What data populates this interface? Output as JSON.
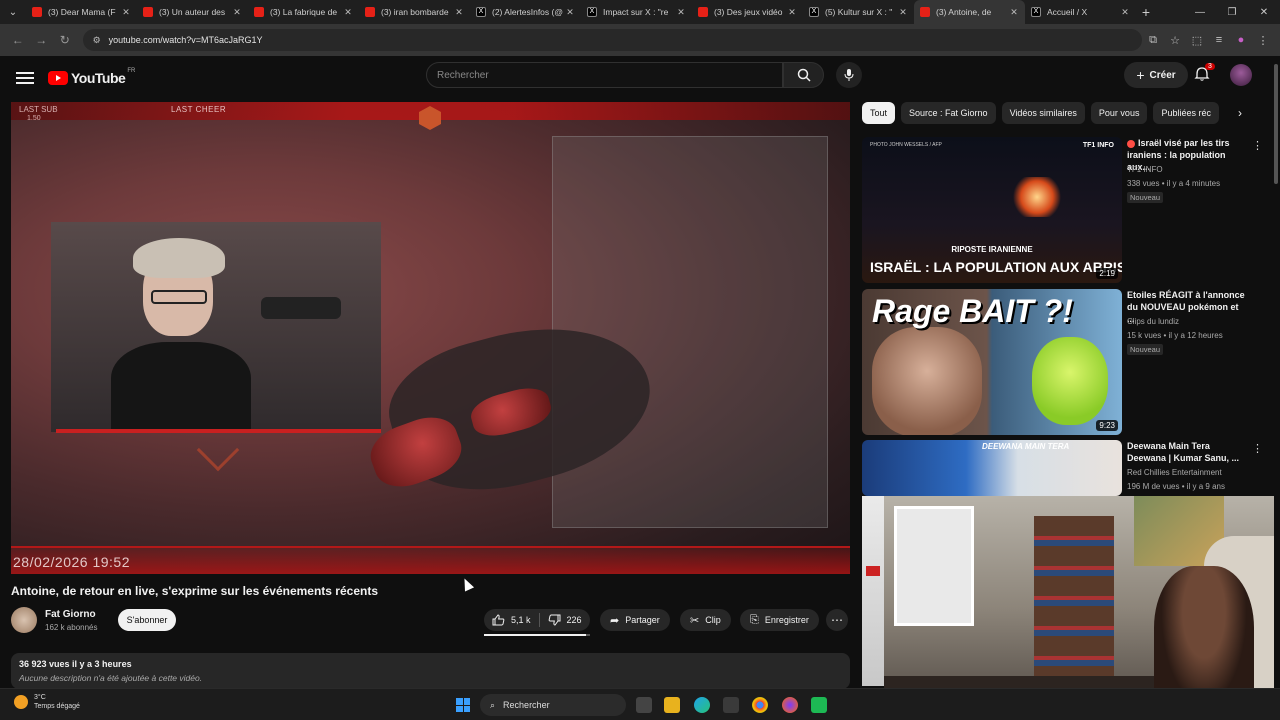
{
  "browser": {
    "tabs": [
      {
        "title": "(3) Dear Mama (F",
        "icon": "youtube-icon"
      },
      {
        "title": "(3) Un auteur des",
        "icon": "youtube-icon"
      },
      {
        "title": "(3) La fabrique de",
        "icon": "youtube-icon"
      },
      {
        "title": "(3) iran bombarde",
        "icon": "youtube-icon"
      },
      {
        "title": "(2) AlertesInfos (@",
        "icon": "x-icon"
      },
      {
        "title": "Impact sur X : \"re",
        "icon": "x-icon"
      },
      {
        "title": "(3) Des jeux vidéo",
        "icon": "youtube-icon"
      },
      {
        "title": "(5) Kultur sur X : \"",
        "icon": "x-icon"
      },
      {
        "title": "(3) Antoine, de",
        "icon": "youtube-icon",
        "active": true
      },
      {
        "title": "Accueil / X",
        "icon": "x-icon"
      }
    ],
    "url": "youtube.com/watch?v=MT6acJaRG1Y"
  },
  "youtube": {
    "logo_text": "YouTube",
    "region": "FR",
    "search_placeholder": "Rechercher",
    "create_label": "Créer",
    "notif_count": "3"
  },
  "player": {
    "overlay_last_sub": "LAST SUB",
    "overlay_last_sub_value": "1.50",
    "overlay_last_cheer": "LAST CHEER",
    "timestamp": "28/02/2026   19:52"
  },
  "video": {
    "title": "Antoine, de retour en live, s'exprime sur les événements récents",
    "channel": "Fat Giorno",
    "subscribers": "162 k abonnés",
    "subscribe_label": "S'abonner",
    "likes": "5,1 k",
    "dislikes": "226",
    "share_label": "Partager",
    "clip_label": "Clip",
    "save_label": "Enregistrer",
    "views_date": "36 923 vues  il y a 3 heures",
    "description": "Aucune description n'a été ajoutée à cette vidéo."
  },
  "chips": [
    "Tout",
    "Source : Fat Giorno",
    "Vidéos similaires",
    "Pour vous",
    "Publiées réc"
  ],
  "recommendations": [
    {
      "title": "Israël visé par les tirs iraniens : la population aux...",
      "channel": "TF1 INFO",
      "meta": "338 vues • il y a 4 minutes",
      "badge": "Nouveau",
      "duration": "2:19",
      "thumb_caption_small": "RIPOSTE IRANIENNE",
      "thumb_caption_big": "ISRAËL : LA POPULATION AUX ABRIS",
      "thumb_brand": "TF1 INFO",
      "thumb_credit": "PHOTO JOHN WESSELS / AFP"
    },
    {
      "title": "Etoiles RÉAGIT à l'annonce du NOUVEAU pokémon et ...",
      "channel": "Clips du lundiz",
      "meta": "15 k vues • il y a 12 heures",
      "badge": "Nouveau",
      "duration": "9:23",
      "thumb_caption_big": "Rage BAIT ?!"
    },
    {
      "title": "Deewana Main Tera Deewana | Kumar Sanu, ...",
      "channel": "Red Chillies Entertainment",
      "meta": "196 M de vues • il y a 9 ans",
      "thumb_caption_big": "DEEWANA MAIN TERA"
    }
  ],
  "taskbar": {
    "temp": "3°C",
    "weather": "Temps dégagé",
    "search_label": "Rechercher"
  }
}
